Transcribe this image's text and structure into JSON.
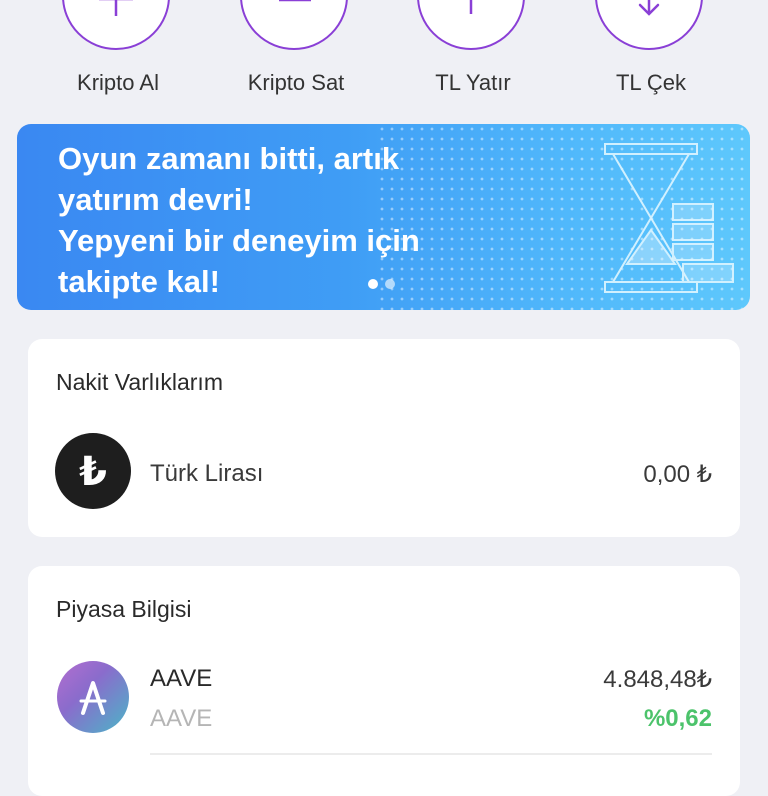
{
  "actions": [
    {
      "label": "Kripto Al",
      "icon": "plus-icon"
    },
    {
      "label": "Kripto Sat",
      "icon": "minus-icon"
    },
    {
      "label": "TL Yatır",
      "icon": "arrow-up-icon"
    },
    {
      "label": "TL Çek",
      "icon": "arrow-down-icon"
    }
  ],
  "banner": {
    "line1": "Oyun zamanı bitti, artık",
    "line2": "yatırım devri!",
    "line3": "Yepyeni bir deneyim için",
    "line4": "takipte kal!",
    "pages": 2,
    "active_page": 1
  },
  "cash": {
    "title": "Nakit Varlıklarım",
    "asset": {
      "icon": "turkish-lira-icon",
      "name": "Türk Lirası",
      "value": "0,00 ₺"
    }
  },
  "market": {
    "title": "Piyasa Bilgisi",
    "items": [
      {
        "icon": "aave-icon",
        "name": "AAVE",
        "symbol": "AAVE",
        "price": "4.848,48₺",
        "change": "%0,62"
      }
    ]
  },
  "colors": {
    "accent": "#8a3fd6",
    "positive": "#4cc36b",
    "background": "#eff0f5"
  }
}
